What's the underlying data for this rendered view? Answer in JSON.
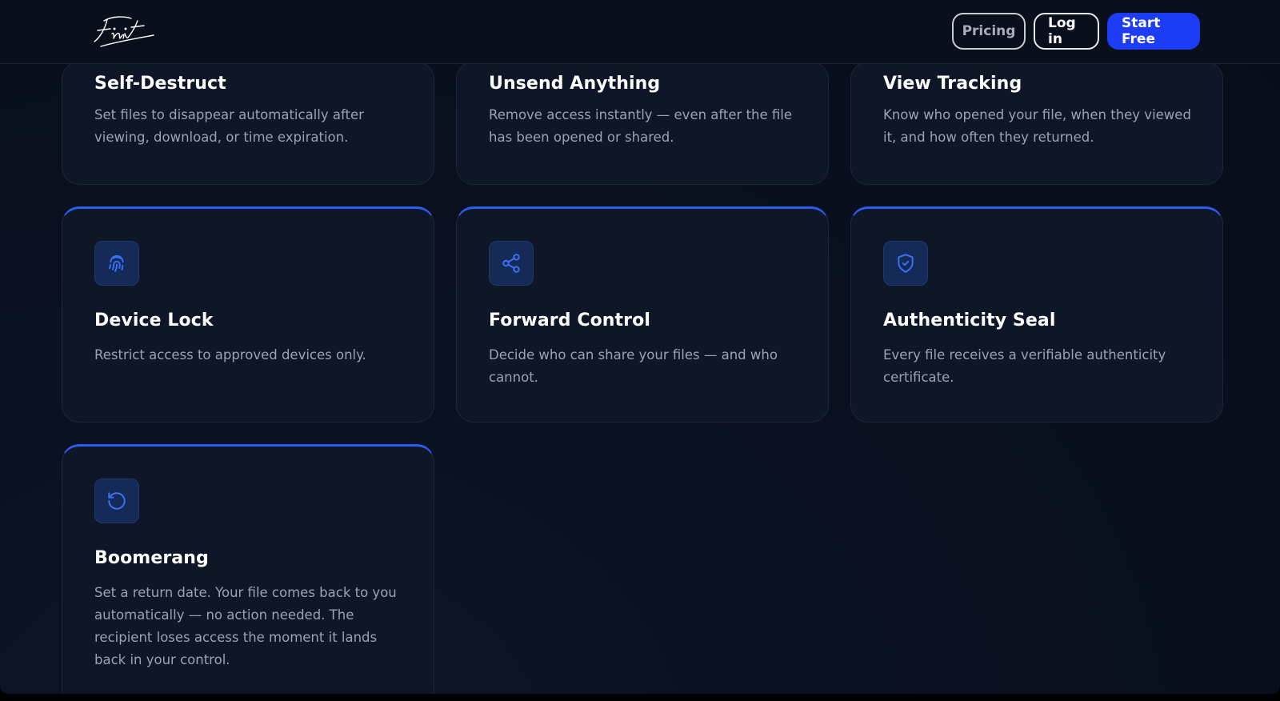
{
  "header": {
    "logo_text": "Finit",
    "pricing_label": "Pricing",
    "login_label": "Log in",
    "start_label": "Start Free"
  },
  "colors": {
    "accent": "#2b5cf0",
    "primary_button": "#1d3cf5",
    "card_bg": "#0e1628",
    "page_bg": "#0a1120"
  },
  "features": [
    {
      "title": "Self-Destruct",
      "desc": "Set files to disappear automatically after viewing, download, or time expiration."
    },
    {
      "title": "Unsend Anything",
      "desc": "Remove access instantly — even after the file has been opened or shared."
    },
    {
      "title": "View Tracking",
      "desc": "Know who opened your file, when they viewed it, and how often they returned."
    },
    {
      "title": "Device Lock",
      "desc": "Restrict access to approved devices only.",
      "icon": "fingerprint-icon"
    },
    {
      "title": "Forward Control",
      "desc": "Decide who can share your files — and who cannot.",
      "icon": "share-icon"
    },
    {
      "title": "Authenticity Seal",
      "desc": "Every file receives a verifiable authenticity certificate.",
      "icon": "shield-check-icon"
    },
    {
      "title": "Boomerang",
      "desc": "Set a return date. Your file comes back to you automatically — no action needed. The recipient loses access the moment it lands back in your control.",
      "icon": "rotate-ccw-icon"
    }
  ]
}
